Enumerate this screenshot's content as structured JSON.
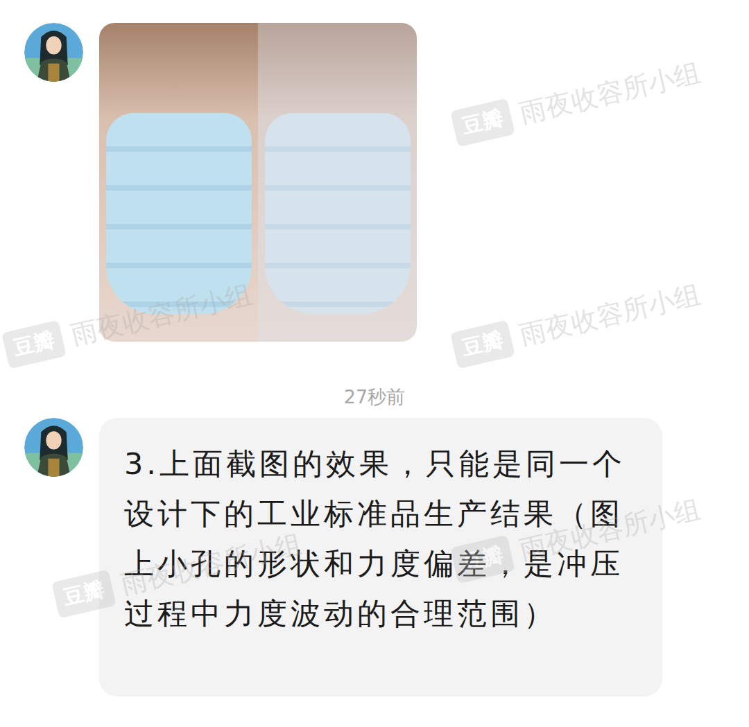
{
  "messages": [
    {
      "kind": "image",
      "from_other": true
    },
    {
      "kind": "time",
      "text": "27秒前"
    },
    {
      "kind": "text",
      "from_other": true,
      "text": "3.上面截图的效果，只能是同一个设计下的工业标准品生产结果（图上小孔的形状和力度偏差，是冲压过程中力度波动的合理范围）"
    }
  ],
  "watermark": {
    "logo": "豆瓣",
    "text": "雨夜收容所小组"
  }
}
